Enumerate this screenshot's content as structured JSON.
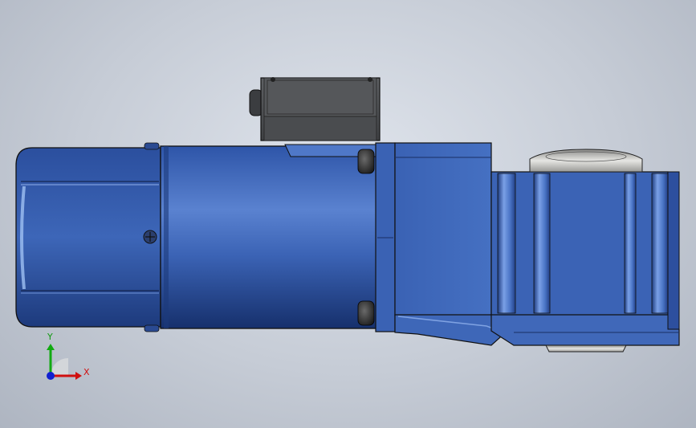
{
  "viewport": {
    "background_top": "#dfe4ec",
    "background_bottom": "#aeb5c1"
  },
  "model": {
    "body_color": "#3b63b5",
    "highlight_color": "#6f95dc",
    "shadow_color": "#17306b",
    "terminal_box_color": "#4d4f52",
    "shaft_color": "#c9c9c6"
  },
  "triad": {
    "x_label": "X",
    "y_label": "Y",
    "x_color": "#d01010",
    "y_color": "#11aa11",
    "z_color": "#1020d0"
  }
}
